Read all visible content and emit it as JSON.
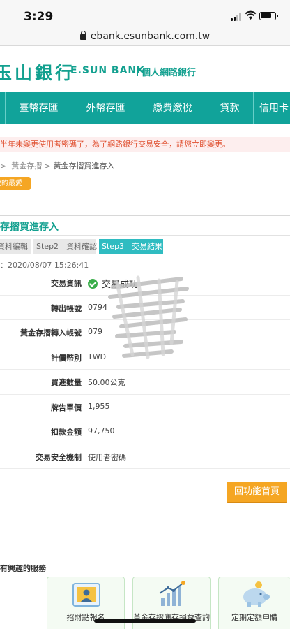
{
  "status_bar": {
    "time": "3:29",
    "battery_level": 0.8
  },
  "browser": {
    "url": "ebank.esunbank.com.tw"
  },
  "brand": {
    "name_zh": "玉山銀行",
    "name_en": "E.SUN BANK",
    "subtitle": "個人網路銀行",
    "color": "#12a08f"
  },
  "nav": {
    "items": [
      "",
      "臺幣存匯",
      "外幣存匯",
      "繳費繳稅",
      "貸款",
      "信用卡"
    ]
  },
  "notice": {
    "text": "半年未變更使用者密碼了，為了網路銀行交易安全，請您",
    "link": "立即變更",
    "end": "。"
  },
  "breadcrumb": {
    "sep1": ">",
    "parent": "黃金存摺",
    "sep2": ">",
    "current": "黃金存摺買進存入"
  },
  "favorite_button": "我的最愛",
  "page_title": "存摺買進存入",
  "steps": [
    {
      "label": "資料編輯"
    },
    {
      "label": "Step2　資料確認"
    },
    {
      "label": "Step3　交易結果"
    }
  ],
  "timestamp": "：2020/08/07 15:26:41",
  "result": [
    {
      "label": "交易資訊",
      "value": "交易成功"
    },
    {
      "label": "轉出帳號",
      "value": "0794"
    },
    {
      "label": "黃金存摺轉入帳號",
      "value": "079"
    },
    {
      "label": "計價幣別",
      "value": "TWD"
    },
    {
      "label": "買進數量",
      "value": "50.00公克"
    },
    {
      "label": "牌告單價",
      "value": "1,955"
    },
    {
      "label": "扣款金額",
      "value": "97,750"
    },
    {
      "label": "交易安全機制",
      "value": "使用者密碼"
    }
  ],
  "home_button": "回功能首頁",
  "services": {
    "title": "有興趣的服務",
    "cards": [
      {
        "label": "招財點報名",
        "icon": "user-card-icon"
      },
      {
        "label": "黃金存摺庫存損益查詢",
        "icon": "gold-chart-icon"
      },
      {
        "label": "定期定額申購",
        "icon": "piggy-bank-icon"
      }
    ]
  },
  "colors": {
    "nav_bg": "#11a39a",
    "accent_orange": "#f5a623",
    "step_active": "#2fbcc1",
    "notice_red": "#e05030"
  }
}
